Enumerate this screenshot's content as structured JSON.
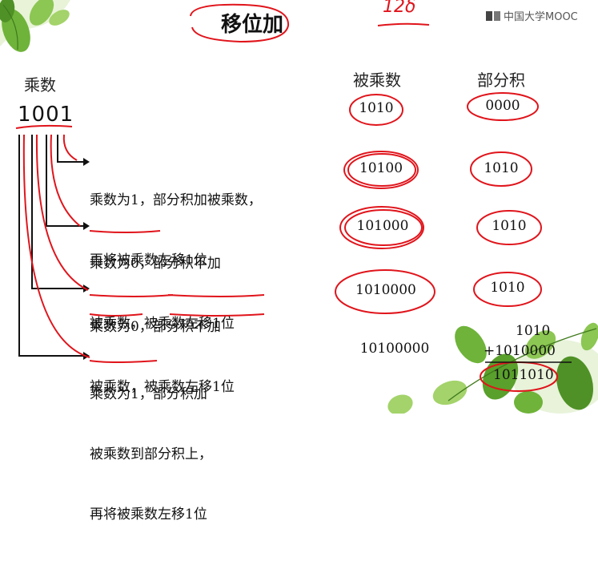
{
  "title": "移位加",
  "scribble_top": "12δ",
  "brand": {
    "logo_text": "中国大学MOOC"
  },
  "left_header": "乘数",
  "multiplier": "1001",
  "notes": [
    {
      "line1": "乘数为1，部分积加被乘数，",
      "line2": "再将被乘数左移1位"
    },
    {
      "line1": "乘数为0，部分积不加",
      "line2": "被乘数，被乘数左移1位"
    },
    {
      "line1": "乘数为0，部分积不加",
      "line2": "被乘数，被乘数左移1位"
    },
    {
      "line1": "乘数为1，部分积加",
      "line2": "被乘数到部分积上，",
      "line3": "再将被乘数左移1位"
    }
  ],
  "columns": {
    "multiplicand": "被乘数",
    "partial": "部分积"
  },
  "multiplicand_values": [
    "1010",
    "10100",
    "101000",
    "1010000",
    "10100000"
  ],
  "partial_values": [
    "0000",
    "1010",
    "1010",
    "1010"
  ],
  "sum": {
    "top": "1010",
    "addend": "+1010000",
    "result": "1011010"
  },
  "colors": {
    "ink": "#1a1a1a",
    "annotation": "#e0141b",
    "leaf": "#5aa02c"
  }
}
